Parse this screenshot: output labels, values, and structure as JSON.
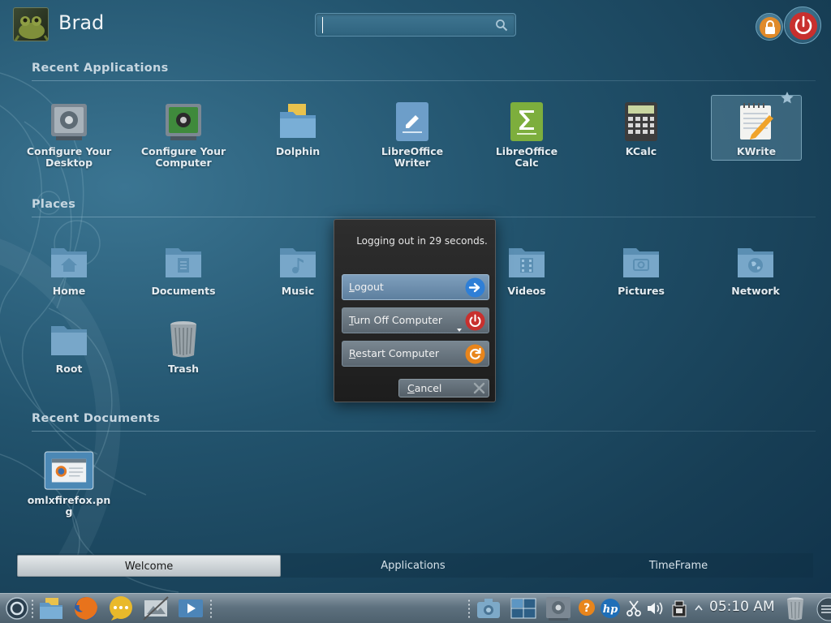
{
  "header": {
    "user_name": "Brad",
    "search": {
      "value": "",
      "placeholder": ""
    }
  },
  "sections": {
    "recent_apps": "Recent Applications",
    "places": "Places",
    "recent_docs": "Recent Documents"
  },
  "recent_apps": [
    {
      "line1": "Configure Your",
      "line2": "Desktop",
      "icon": "desktop-settings-icon"
    },
    {
      "line1": "Configure Your",
      "line2": "Computer",
      "icon": "computer-settings-icon"
    },
    {
      "line1": "Dolphin",
      "line2": "",
      "icon": "dolphin-folder-icon"
    },
    {
      "line1": "LibreOffice",
      "line2": "Writer",
      "icon": "writer-icon"
    },
    {
      "line1": "LibreOffice",
      "line2": "Calc",
      "icon": "calc-icon"
    },
    {
      "line1": "KCalc",
      "line2": "",
      "icon": "calculator-icon"
    },
    {
      "line1": "KWrite",
      "line2": "",
      "icon": "kwrite-icon"
    }
  ],
  "places": [
    {
      "label": "Home",
      "icon": "home-folder-icon"
    },
    {
      "label": "Documents",
      "icon": "documents-folder-icon"
    },
    {
      "label": "Music",
      "icon": "music-folder-icon"
    },
    {
      "label": "Videos",
      "icon": "videos-folder-icon"
    },
    {
      "label": "Pictures",
      "icon": "pictures-folder-icon"
    },
    {
      "label": "Network",
      "icon": "network-folder-icon"
    },
    {
      "label": "Root",
      "icon": "root-folder-icon"
    },
    {
      "label": "Trash",
      "icon": "trash-icon"
    }
  ],
  "recent_docs": [
    {
      "line1": "omlxfirefox.pn",
      "line2": "g",
      "icon": "image-thumbnail-icon"
    }
  ],
  "tabs": {
    "welcome": "Welcome",
    "applications": "Applications",
    "timeframe": "TimeFrame"
  },
  "dialog": {
    "message": "Logging out in 29 seconds.",
    "logout": {
      "accel": "L",
      "rest": "ogout"
    },
    "turn_off": {
      "accel": "T",
      "rest": "urn Off Computer"
    },
    "restart": {
      "accel": "R",
      "rest": "estart Computer"
    },
    "cancel": {
      "accel": "C",
      "rest": "ancel"
    }
  },
  "taskbar": {
    "clock": "05:10 AM"
  },
  "colors": {
    "accent_blue": "#2f7fd6",
    "power_red": "#c8302e",
    "restart_orange": "#e8851c",
    "lock_orange": "#e08a2a"
  }
}
